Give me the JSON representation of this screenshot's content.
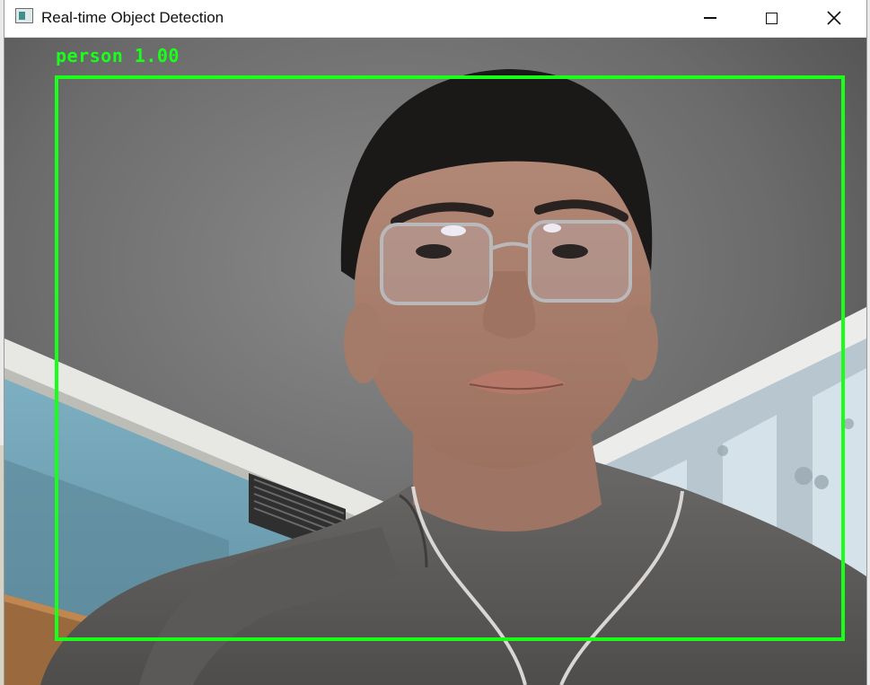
{
  "window": {
    "title": "Real-time Object Detection",
    "icon": "opencv-window-icon",
    "controls": [
      "minimize-icon",
      "maximize-icon",
      "close-icon"
    ]
  },
  "feed": {
    "description_icon": "webcam-frame",
    "detection": {
      "label": "person 1.00",
      "box_color": "#19ff19"
    }
  }
}
